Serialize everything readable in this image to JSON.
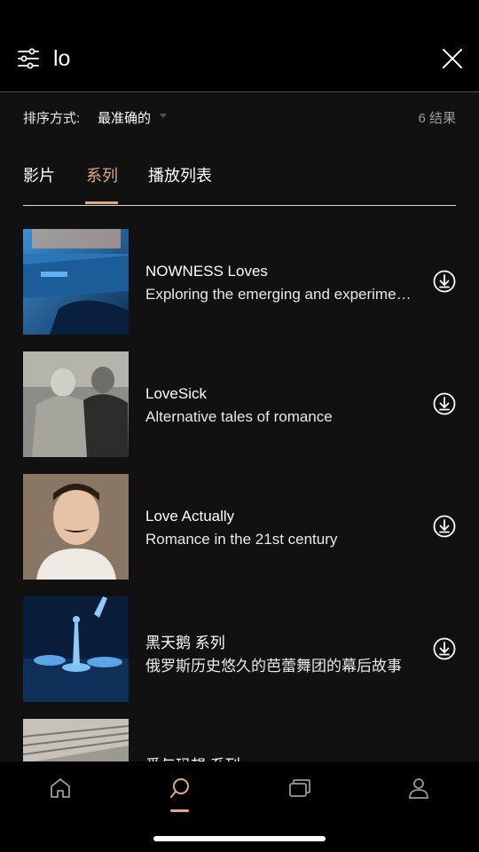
{
  "header": {
    "search_value": "lo",
    "filter_icon": "sliders-icon",
    "close_icon": "close-icon"
  },
  "sort": {
    "label": "排序方式:",
    "value": "最准确的",
    "result_count": "6 结果"
  },
  "tabs": [
    {
      "label": "影片",
      "active": false
    },
    {
      "label": "系列",
      "active": true
    },
    {
      "label": "播放列表",
      "active": false
    }
  ],
  "results": [
    {
      "title": "NOWNESS Loves",
      "subtitle": "Exploring the emerging and experimental",
      "icon": "download-icon"
    },
    {
      "title": "LoveSick",
      "subtitle": "Alternative tales of romance",
      "icon": "download-icon"
    },
    {
      "title": "Love Actually",
      "subtitle": "Romance in the 21st century",
      "icon": "download-icon"
    },
    {
      "title": "黑天鹅 系列",
      "subtitle": "俄罗斯历史悠久的芭蕾舞团的幕后故事",
      "icon": "download-icon"
    },
    {
      "title": "爱与玛想 系列",
      "subtitle": "",
      "icon": "download-icon"
    }
  ],
  "bottom_nav": {
    "items": [
      "home-icon",
      "search-icon",
      "collections-icon",
      "profile-icon"
    ],
    "active": "search-icon"
  },
  "colors": {
    "accent": "#e0a887",
    "background": "#111112",
    "header_bg": "#000000"
  }
}
